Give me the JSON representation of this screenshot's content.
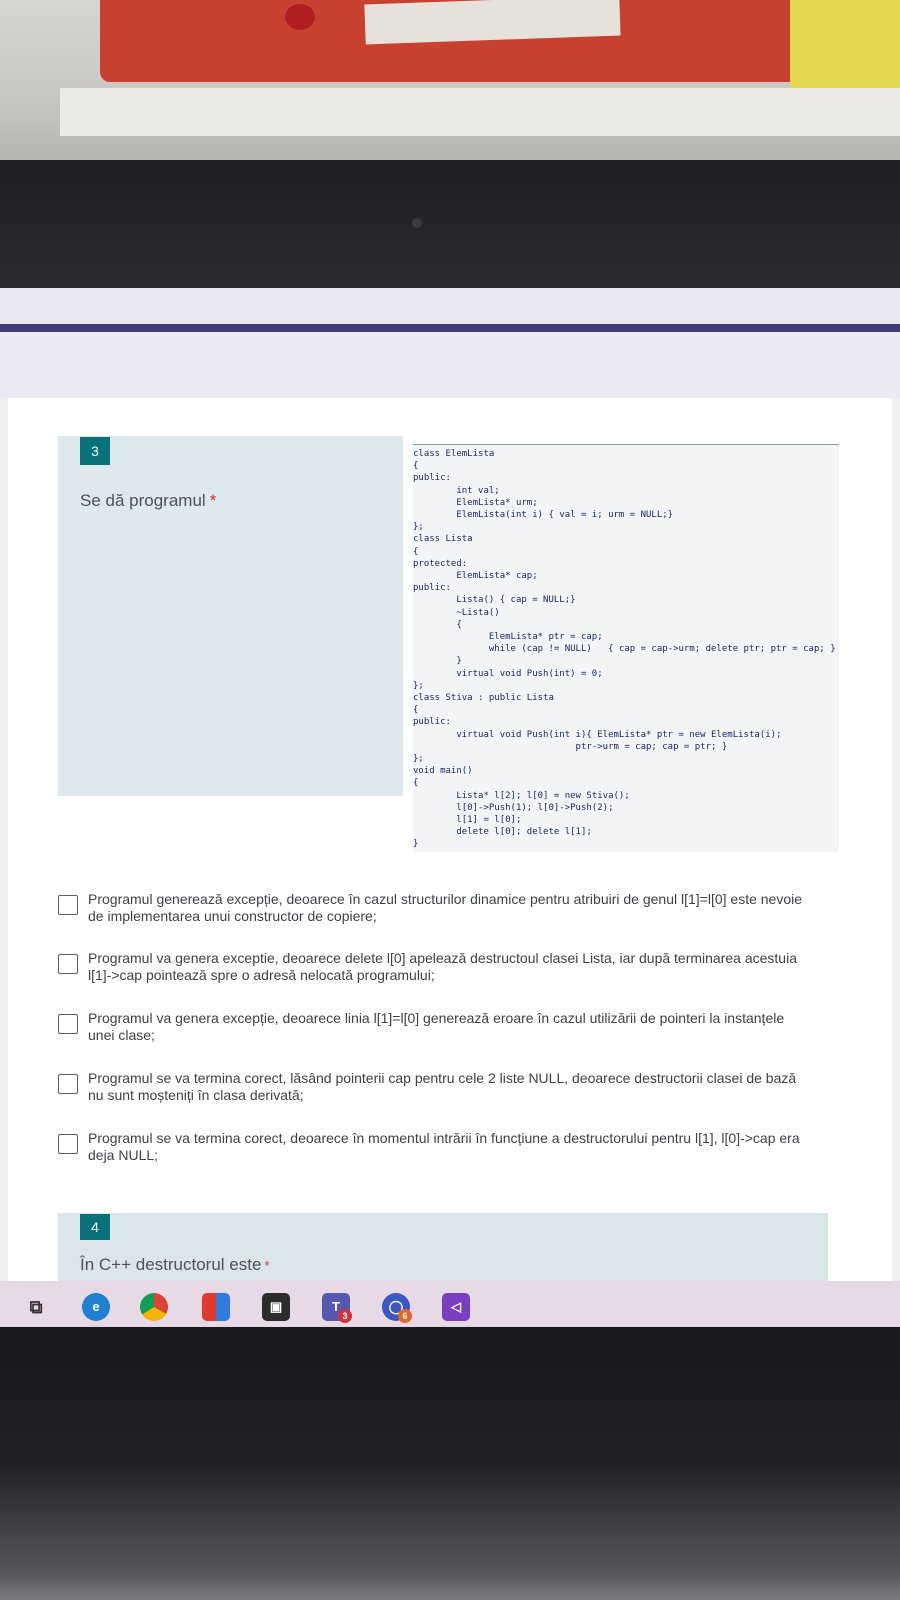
{
  "question3": {
    "number": "3",
    "text": "Se dă programul",
    "required_mark": "*",
    "code_lines": [
      "class ElemLista",
      "{",
      "public:",
      "        int val;",
      "        ElemLista* urm;",
      "        ElemLista(int i) { val = i; urm = NULL;}",
      "};",
      "class Lista",
      "{",
      "protected:",
      "        ElemLista* cap;",
      "public:",
      "        Lista() { cap = NULL;}",
      "        ~Lista()",
      "        {",
      "              ElemLista* ptr = cap;",
      "              while (cap != NULL)   { cap = cap->urm; delete ptr; ptr = cap; }",
      "        }",
      "        virtual void Push(int) = 0;",
      "};",
      "class Stiva : public Lista",
      "{",
      "public:",
      "        virtual void Push(int i){ ElemLista* ptr = new ElemLista(i);",
      "                              ptr->urm = cap; cap = ptr; }",
      "};",
      "void main()",
      "{",
      "        Lista* l[2]; l[0] = new Stiva();",
      "        l[0]->Push(1); l[0]->Push(2);",
      "        l[1] = l[0];",
      "        delete l[0]; delete l[1];",
      "}"
    ],
    "options": [
      "Programul generează excepție, deoarece în cazul structurilor dinamice pentru atribuiri de genul l[1]=l[0] este nevoie de implementarea unui constructor de copiere;",
      "Programul va genera exceptie, deoarece delete l[0] apelează destructoul clasei Lista, iar după terminarea acestuia l[1]->cap pointează spre o adresă nelocată programului;",
      "Programul va genera excepție, deoarece linia l[1]=l[0] generează eroare în cazul utilizării de pointeri la instanțele unei clase;",
      "Programul se va termina corect, lăsând pointerii cap pentru cele 2 liste NULL, deoarece destructorii clasei de bază nu sunt moșteniți în clasa derivată;",
      "Programul se va termina corect, deoarece în momentul intrării în funcțiune a destructorului pentru l[1], l[0]->cap era deja NULL;"
    ]
  },
  "question4": {
    "number": "4",
    "text": "În C++ destructorul este",
    "required_mark": "*"
  },
  "taskbar": {
    "icons": [
      "task-view-icon",
      "edge-icon",
      "chrome-icon",
      "office-icon",
      "store-icon",
      "teams-icon",
      "brave-icon",
      "visual-studio-icon"
    ],
    "teams_badge": "3",
    "brave_badge": "6"
  },
  "colors": {
    "accent": "#08717a",
    "header_band": "#3d3a7a",
    "required": "#c0392b"
  }
}
